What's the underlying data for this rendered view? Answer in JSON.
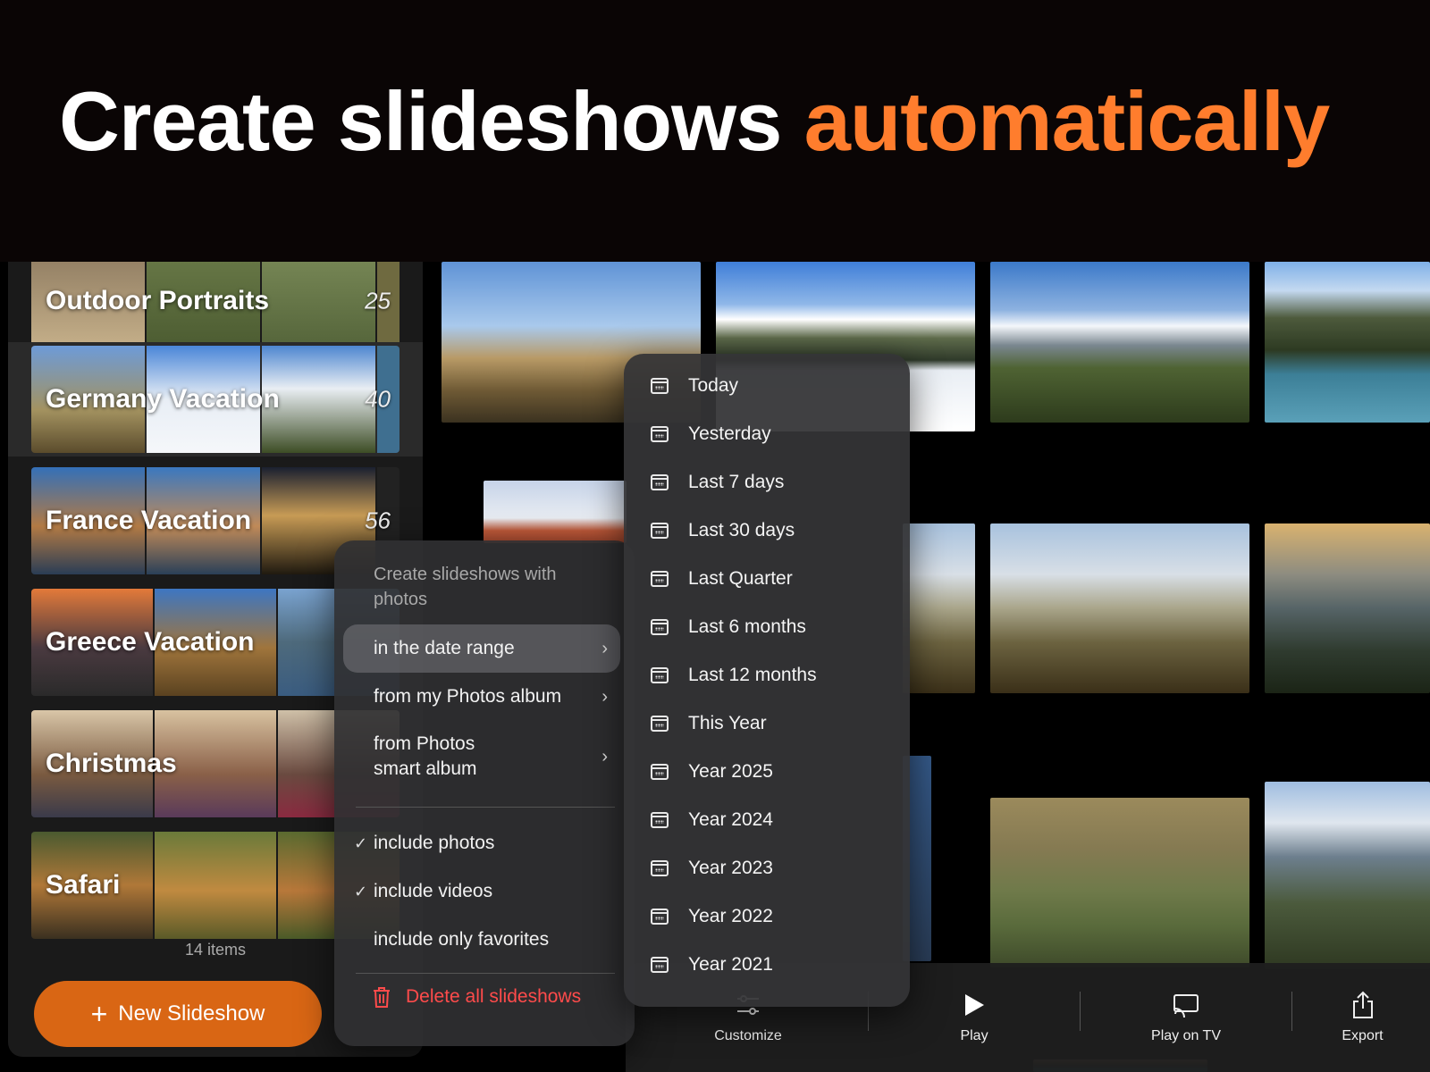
{
  "headline": {
    "main": "Create slideshows ",
    "accent": "automatically"
  },
  "sidebar": {
    "albums": [
      {
        "name": "Outdoor Portraits",
        "count": "25"
      },
      {
        "name": "Germany Vacation",
        "count": "40"
      },
      {
        "name": "France Vacation",
        "count": "56"
      },
      {
        "name": "Greece Vacation",
        "count": ""
      },
      {
        "name": "Christmas",
        "count": ""
      },
      {
        "name": "Safari",
        "count": ""
      }
    ],
    "items_count": "14 items",
    "new_button": "New Slideshow"
  },
  "menu": {
    "header": "Create slideshows with photos",
    "date_range": "in the date range",
    "photos_album": "from my Photos album",
    "smart_album": "from Photos smart album",
    "include_photos": "include photos",
    "include_videos": "include videos",
    "include_favorites": "include only favorites",
    "delete_all": "Delete all slideshows"
  },
  "date_submenu": {
    "items": [
      "Today",
      "Yesterday",
      "Last 7 days",
      "Last 30 days",
      "Last Quarter",
      "Last 6 months",
      "Last 12 months",
      "This Year",
      "Year 2025",
      "Year 2024",
      "Year 2023",
      "Year 2022",
      "Year 2021"
    ]
  },
  "toolbar": {
    "customize": "Customize",
    "play": "Play",
    "play_tv": "Play on TV",
    "export": "Export"
  },
  "colors": {
    "accent": "#ff7d2d",
    "button": "#d96614",
    "delete": "#ff4b4b"
  }
}
